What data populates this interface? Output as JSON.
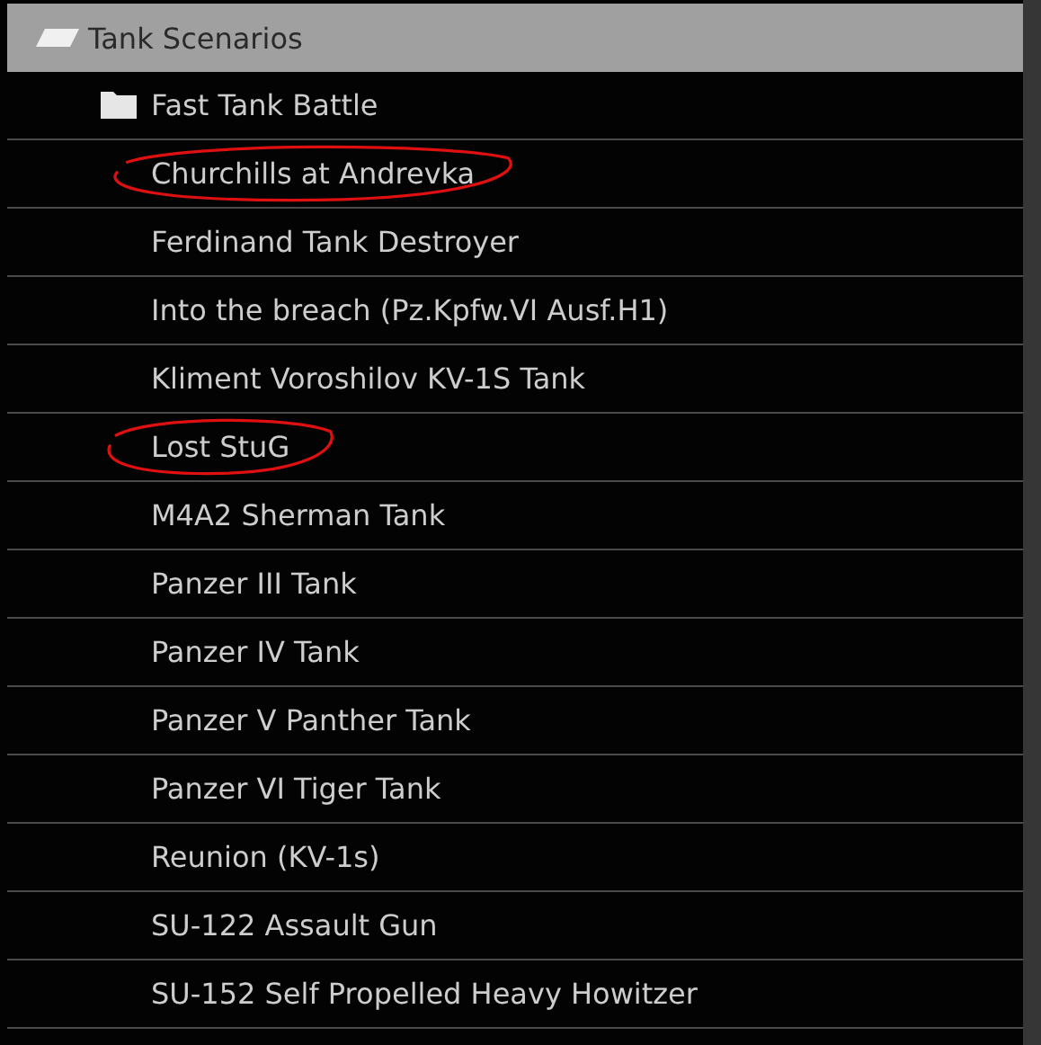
{
  "header": {
    "title": "Tank Scenarios",
    "expanded": true
  },
  "items": [
    {
      "kind": "folder",
      "label": "Fast Tank Battle",
      "circled": false
    },
    {
      "kind": "scenario",
      "label": "Churchills at Andrevka",
      "circled": true
    },
    {
      "kind": "scenario",
      "label": "Ferdinand Tank Destroyer",
      "circled": false
    },
    {
      "kind": "scenario",
      "label": "Into the breach (Pz.Kpfw.VI Ausf.H1)",
      "circled": false
    },
    {
      "kind": "scenario",
      "label": "Kliment Voroshilov KV-1S Tank",
      "circled": false
    },
    {
      "kind": "scenario",
      "label": "Lost StuG",
      "circled": true
    },
    {
      "kind": "scenario",
      "label": "M4A2 Sherman Tank",
      "circled": false
    },
    {
      "kind": "scenario",
      "label": "Panzer III Tank",
      "circled": false
    },
    {
      "kind": "scenario",
      "label": "Panzer IV Tank",
      "circled": false
    },
    {
      "kind": "scenario",
      "label": "Panzer V Panther Tank",
      "circled": false
    },
    {
      "kind": "scenario",
      "label": "Panzer VI Tiger Tank",
      "circled": false
    },
    {
      "kind": "scenario",
      "label": "Reunion (KV-1s)",
      "circled": false
    },
    {
      "kind": "scenario",
      "label": "SU-122 Assault Gun",
      "circled": false
    },
    {
      "kind": "scenario",
      "label": "SU-152 Self Propelled Heavy Howitzer",
      "circled": false
    }
  ]
}
